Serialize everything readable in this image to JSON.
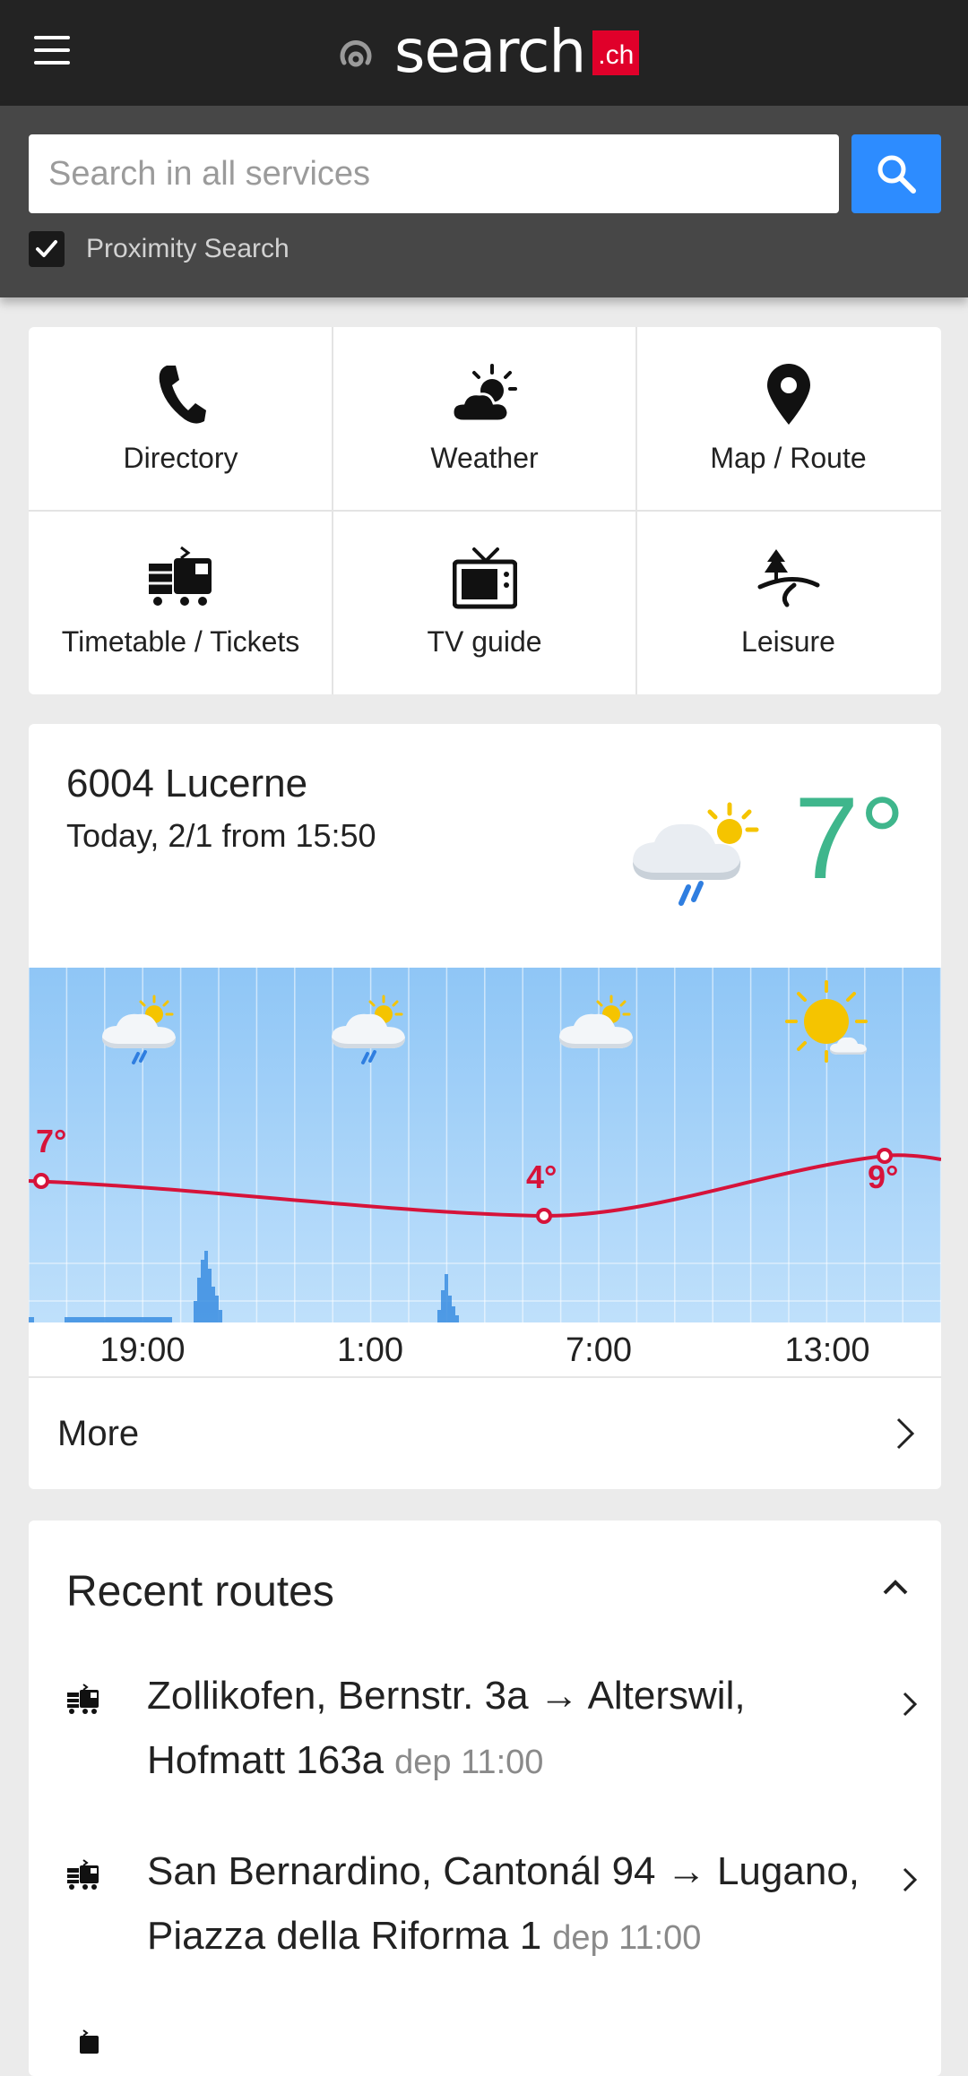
{
  "header": {
    "logo_text": "search",
    "logo_badge": ".ch"
  },
  "search": {
    "placeholder": "Search in all services",
    "proximity_label": "Proximity Search",
    "proximity_checked": true
  },
  "services": [
    {
      "label": "Directory",
      "icon": "phone-icon"
    },
    {
      "label": "Weather",
      "icon": "weather-icon"
    },
    {
      "label": "Map / Route",
      "icon": "map-pin-icon"
    },
    {
      "label": "Timetable / Tickets",
      "icon": "train-icon"
    },
    {
      "label": "TV guide",
      "icon": "tv-icon"
    },
    {
      "label": "Leisure",
      "icon": "leisure-icon"
    }
  ],
  "weather": {
    "location": "6004 Lucerne",
    "date": "Today, 2/1 from 15:50",
    "current_temp": "7°",
    "times": [
      "19:00",
      "1:00",
      "7:00",
      "13:00"
    ],
    "temp_labels": [
      "7°",
      "4°",
      "9°"
    ],
    "more_label": "More",
    "colors": {
      "temp_line": "#d6133a",
      "temp_big": "#3fb68c",
      "sky": "#92c9f7"
    }
  },
  "routes": {
    "title": "Recent routes",
    "items": [
      {
        "text": "Zollikofen, Bernstr. 3a → Alterswil, Hofmatt 163a",
        "dep": "dep 11:00"
      },
      {
        "text": "San Bernardino, Cantonál 94 → Lugano, Piazza della Riforma 1",
        "dep": "dep 11:00"
      }
    ]
  }
}
